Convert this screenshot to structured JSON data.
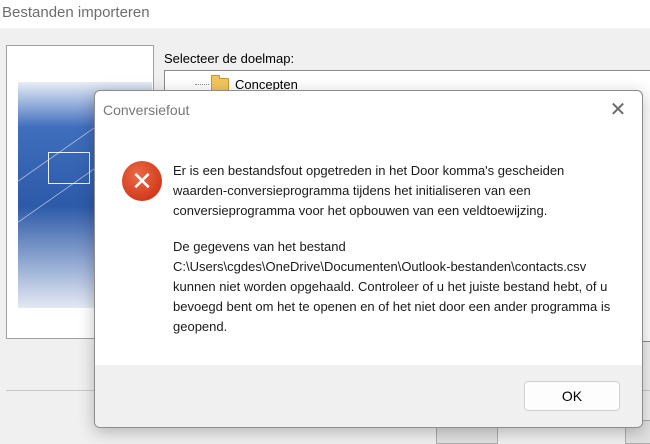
{
  "background_window": {
    "title": "Bestanden importeren",
    "folder_label": "Selecteer de doelmap:",
    "tree_item": "Concepten"
  },
  "dialog": {
    "title": "Conversiefout",
    "close_symbol": "✕",
    "error_symbol": "✕",
    "message_paragraph_1": "Er is een bestandsfout opgetreden in het Door komma's gescheiden waarden-conversieprogramma tijdens het initialiseren van een conversieprogramma voor het opbouwen van een veldtoewijzing.",
    "message_paragraph_2_prefix": "De gegevens van het bestand",
    "message_path": "C:\\Users\\cgdes\\OneDrive\\Documenten\\Outlook-bestanden\\contacts.csv",
    "message_paragraph_2_suffix": "kunnen niet worden opgehaald. Controleer of u het juiste bestand hebt, of u bevoegd bent om het te openen en of het niet door een ander programma is geopend.",
    "ok_label": "OK"
  }
}
